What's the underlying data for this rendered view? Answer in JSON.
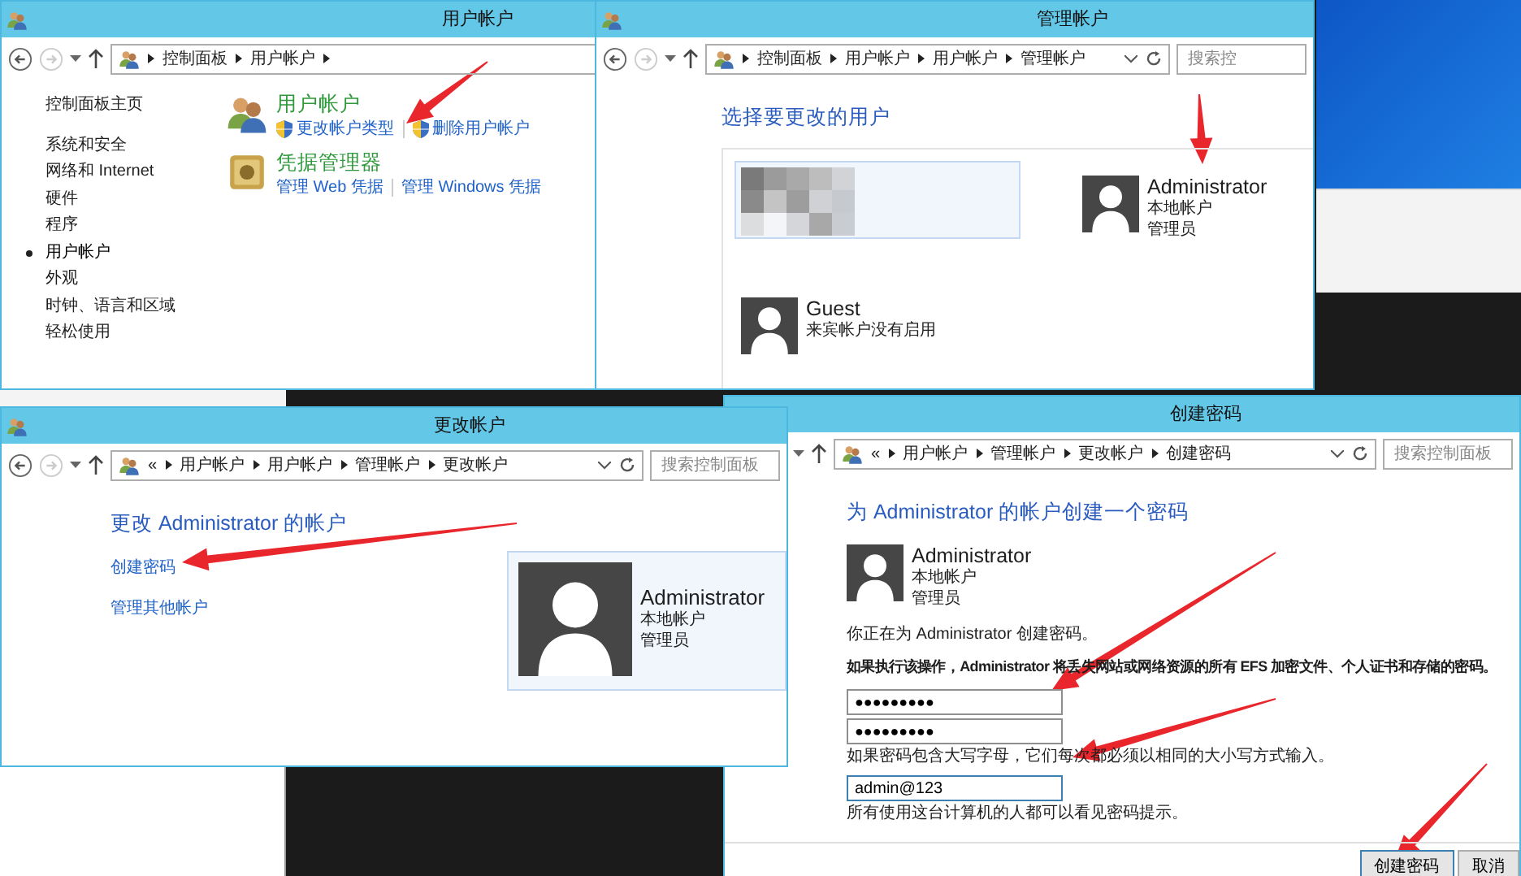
{
  "user_accounts_window": {
    "title": "用户帐户",
    "breadcrumb": [
      "控制面板",
      "用户帐户"
    ],
    "sidebar": [
      {
        "label": "控制面板主页",
        "selected": false
      },
      {
        "label": "系统和安全",
        "selected": false
      },
      {
        "label": "网络和 Internet",
        "selected": false
      },
      {
        "label": "硬件",
        "selected": false
      },
      {
        "label": "程序",
        "selected": false
      },
      {
        "label": "用户帐户",
        "selected": true
      },
      {
        "label": "外观",
        "selected": false
      },
      {
        "label": "时钟、语言和区域",
        "selected": false
      },
      {
        "label": "轻松使用",
        "selected": false
      }
    ],
    "sections": [
      {
        "kind": "users",
        "heading": "用户帐户",
        "links": [
          {
            "label": "更改帐户类型",
            "shield": true
          },
          {
            "label": "删除用户帐户",
            "shield": true
          }
        ]
      },
      {
        "kind": "vault",
        "heading": "凭据管理器",
        "links": [
          {
            "label": "管理 Web 凭据",
            "shield": false
          },
          {
            "label": "管理 Windows 凭据",
            "shield": false
          }
        ]
      }
    ]
  },
  "manage_accounts_window": {
    "title": "管理帐户",
    "breadcrumb": [
      "控制面板",
      "用户帐户",
      "用户帐户",
      "管理帐户"
    ],
    "search_placeholder": "搜索控",
    "heading": "选择要更改的用户",
    "accounts": [
      {
        "kind": "pixelated",
        "selected": true
      },
      {
        "kind": "user",
        "name": "Administrator",
        "details": [
          "本地帐户",
          "管理员"
        ],
        "selected": false
      },
      {
        "kind": "user",
        "name": "Guest",
        "details": [
          "来宾帐户没有启用"
        ],
        "selected": false
      }
    ]
  },
  "change_account_window": {
    "title": "更改帐户",
    "breadcrumb_prefix": "«",
    "breadcrumb": [
      "用户帐户",
      "用户帐户",
      "管理帐户",
      "更改帐户"
    ],
    "search_placeholder": "搜索控制面板",
    "heading": "更改 Administrator 的帐户",
    "links": [
      "创建密码",
      "管理其他帐户"
    ],
    "account": {
      "name": "Administrator",
      "details": [
        "本地帐户",
        "管理员"
      ]
    }
  },
  "create_password_window": {
    "title": "创建密码",
    "breadcrumb_prefix": "«",
    "breadcrumb": [
      "用户帐户",
      "管理帐户",
      "更改帐户",
      "创建密码"
    ],
    "search_placeholder": "搜索控制面板",
    "heading": "为 Administrator 的帐户创建一个密码",
    "account": {
      "name": "Administrator",
      "details": [
        "本地帐户",
        "管理员"
      ]
    },
    "intro": "你正在为 Administrator 创建密码。",
    "warning": "如果执行该操作，Administrator 将丢失网站或网络资源的所有 EFS 加密文件、个人证书和存储的密码。",
    "new_password": "●●●●●●●●●",
    "confirm_password": "●●●●●●●●●",
    "case_note": "如果密码包含大写字母，它们每次都必须以相同的大小写方式输入。",
    "hint_field": {
      "value": "admin@123"
    },
    "hint_note": "所有使用这台计算机的人都可以看见密码提示。",
    "buttons": [
      "创建密码",
      "取消"
    ]
  }
}
